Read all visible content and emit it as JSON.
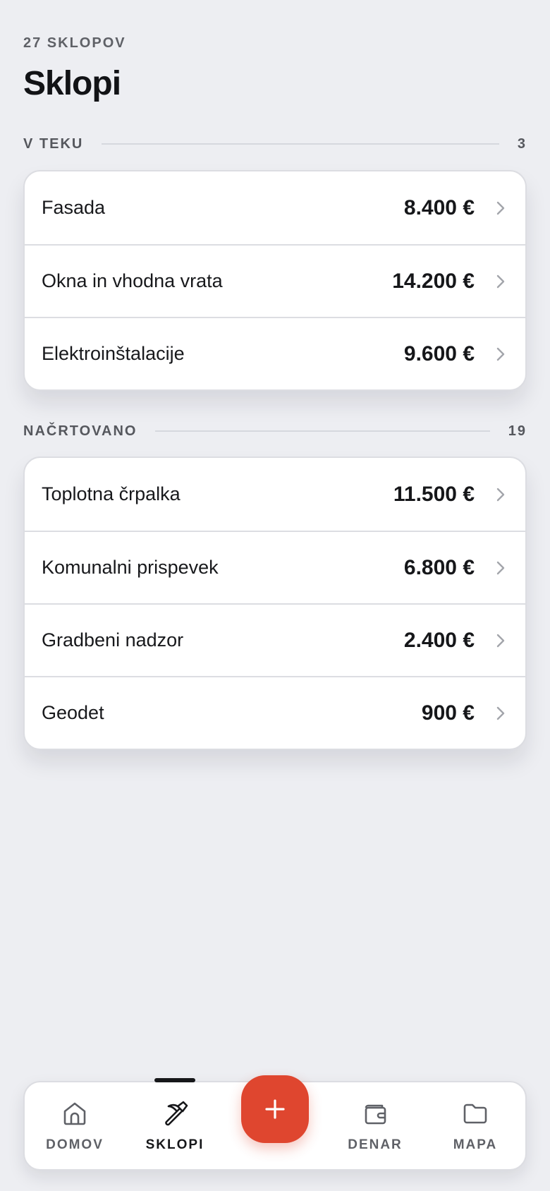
{
  "header": {
    "eyebrow": "27 SKLOPOV",
    "title": "Sklopi"
  },
  "sections": [
    {
      "label": "V TEKU",
      "count": "3",
      "items": [
        {
          "name": "Fasada",
          "amount": "8.400 €"
        },
        {
          "name": "Okna in vhodna vrata",
          "amount": "14.200 €"
        },
        {
          "name": "Elektroinštalacije",
          "amount": "9.600 €"
        }
      ]
    },
    {
      "label": "NAČRTOVANO",
      "count": "19",
      "items": [
        {
          "name": "Toplotna črpalka",
          "amount": "11.500 €"
        },
        {
          "name": "Komunalni prispevek",
          "amount": "6.800 €"
        },
        {
          "name": "Gradbeni nadzor",
          "amount": "2.400 €"
        },
        {
          "name": "Geodet",
          "amount": "900 €"
        }
      ]
    }
  ],
  "nav": {
    "items": [
      {
        "label": "DOMOV",
        "icon": "home-icon"
      },
      {
        "label": "SKLOPI",
        "icon": "hammer-icon",
        "active": true
      },
      {
        "label": "DENAR",
        "icon": "wallet-icon"
      },
      {
        "label": "MAPA",
        "icon": "folder-icon"
      }
    ],
    "fab_icon": "plus-icon"
  },
  "colors": {
    "background": "#edeef2",
    "accent": "#df462f",
    "text": "#16171a",
    "muted": "#5f6167"
  }
}
